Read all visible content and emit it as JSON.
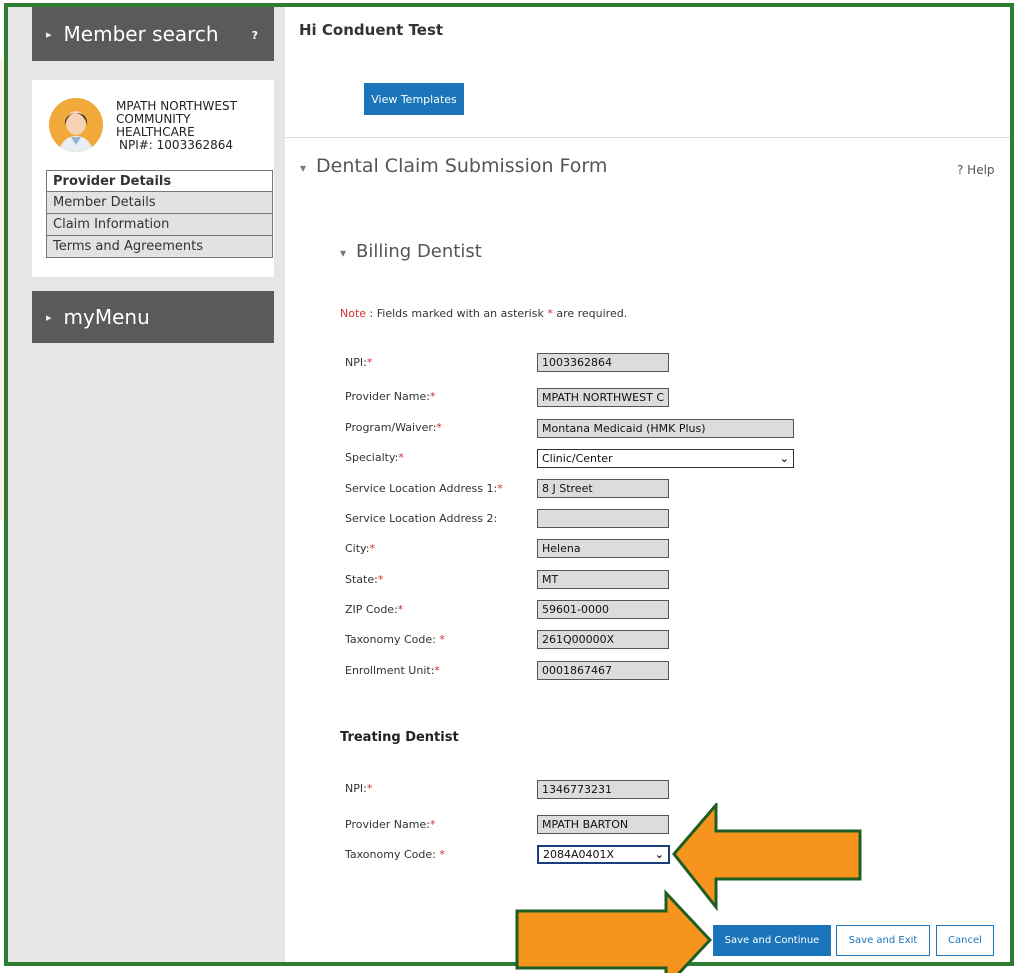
{
  "sidebar": {
    "member_search": "Member search",
    "help_mark": "?",
    "provider": {
      "name_line1": "MPATH NORTHWEST",
      "name_line2": "COMMUNITY",
      "name_line3": "HEALTHCARE",
      "npi": "NPI#: 1003362864"
    },
    "menu": [
      "Provider Details",
      "Member Details",
      "Claim Information",
      "Terms and Agreements"
    ],
    "mymenu": "myMenu"
  },
  "header": {
    "greeting": "Hi Conduent Test",
    "view_templates": "View Templates"
  },
  "form": {
    "title": "Dental Claim Submission Form",
    "help": "? Help",
    "billing_title": "Billing Dentist",
    "note_prefix": "Note",
    "note_text": " : Fields marked with an asterisk ",
    "note_star": "*",
    "note_suffix": " are required.",
    "billing": {
      "npi_label": "NPI:",
      "npi": "1003362864",
      "provider_name_label": "Provider Name:",
      "provider_name": "MPATH NORTHWEST C",
      "program_label": "Program/Waiver:",
      "program": "Montana Medicaid (HMK Plus)",
      "specialty_label": "Specialty:",
      "specialty": "Clinic/Center",
      "addr1_label": "Service Location Address 1:",
      "addr1": "8 J Street",
      "addr2_label": "Service Location Address 2:",
      "addr2": "",
      "city_label": "City:",
      "city": "Helena",
      "state_label": "State:",
      "state": "MT",
      "zip_label": "ZIP Code:",
      "zip": "59601-0000",
      "taxonomy_label": "Taxonomy Code: ",
      "taxonomy": "261Q00000X",
      "enrollment_label": "Enrollment Unit:",
      "enrollment": "0001867467"
    },
    "treating_title": "Treating Dentist",
    "treating": {
      "npi_label": "NPI:",
      "npi": "1346773231",
      "provider_name_label": "Provider Name:",
      "provider_name": "MPATH BARTON",
      "taxonomy_label": "Taxonomy Code: ",
      "taxonomy": "2084A0401X"
    },
    "asterisk": "*",
    "buttons": {
      "save_continue": "Save and Continue",
      "save_exit": "Save and Exit",
      "cancel": "Cancel"
    }
  },
  "colors": {
    "frame": "#2e7d32",
    "sidebar_dark": "#595a5c",
    "primary_blue": "#1b75bb",
    "required_red": "#d32f2f",
    "arrow_orange": "#f7941d"
  }
}
